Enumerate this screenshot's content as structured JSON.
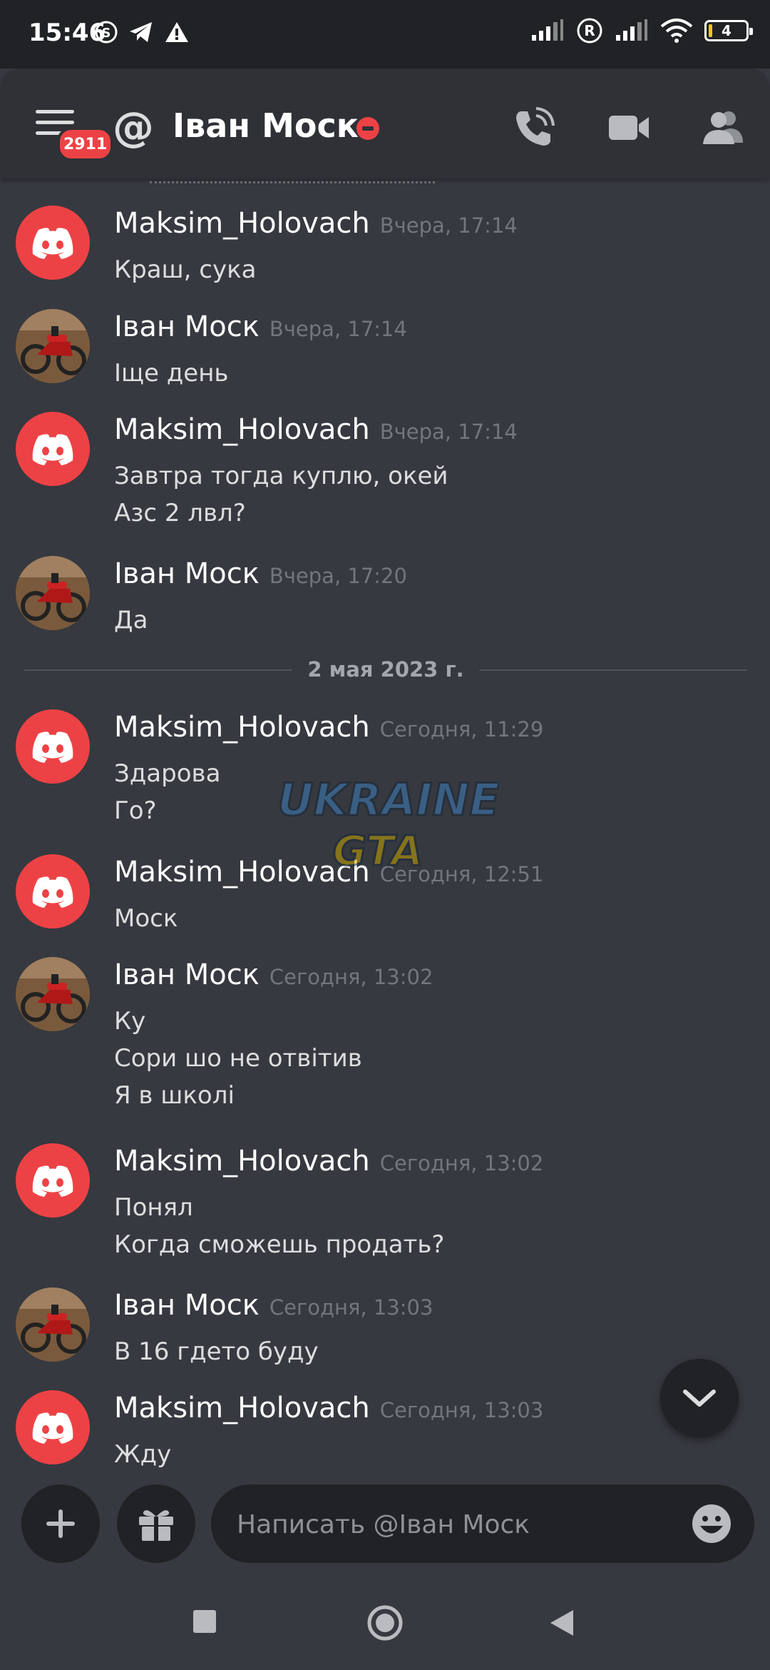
{
  "status_bar": {
    "time": "15:46",
    "battery": "4"
  },
  "header": {
    "menu_badge": "2911",
    "title": "Іван Моск",
    "status": "dnd"
  },
  "messages": [
    {
      "author": "Maksim_Holovach",
      "avatar": "discord",
      "time": "Вчера, 17:14",
      "lines": [
        "Краш, сука"
      ]
    },
    {
      "author": "Іван Моск",
      "avatar": "photo",
      "time": "Вчера, 17:14",
      "lines": [
        "Іще день"
      ]
    },
    {
      "author": "Maksim_Holovach",
      "avatar": "discord",
      "time": "Вчера, 17:14",
      "lines": [
        "Завтра тогда куплю, окей",
        "Азс 2 лвл?"
      ]
    },
    {
      "author": "Іван Моск",
      "avatar": "photo",
      "time": "Вчера, 17:20",
      "lines": [
        "Да"
      ]
    },
    {
      "author": "Maksim_Holovach",
      "avatar": "discord",
      "time": "Сегодня, 11:29",
      "lines": [
        "Здарова",
        "Го?"
      ]
    },
    {
      "author": "Maksim_Holovach",
      "avatar": "discord",
      "time": "Сегодня, 12:51",
      "lines": [
        "Моск"
      ]
    },
    {
      "author": "Іван Моск",
      "avatar": "photo",
      "time": "Сегодня, 13:02",
      "lines": [
        "Ку",
        "Сори шо не отвітив",
        "Я в школі"
      ]
    },
    {
      "author": "Maksim_Holovach",
      "avatar": "discord",
      "time": "Сегодня, 13:02",
      "lines": [
        "Понял",
        "Когда сможешь продать?"
      ]
    },
    {
      "author": "Іван Моск",
      "avatar": "photo",
      "time": "Сегодня, 13:03",
      "lines": [
        "В 16 гдето буду"
      ]
    },
    {
      "author": "Maksim_Holovach",
      "avatar": "discord",
      "time": "Сегодня, 13:03",
      "lines": [
        "Жду"
      ]
    }
  ],
  "date_divider": "2 мая 2023 г.",
  "watermark": {
    "line1": "UKRAINE",
    "line2": "GTA"
  },
  "composer": {
    "placeholder": "Написать @Іван Моск"
  },
  "colors": {
    "accent_red": "#ed4245",
    "background": "#36393f",
    "header_bg": "#2f3136"
  }
}
